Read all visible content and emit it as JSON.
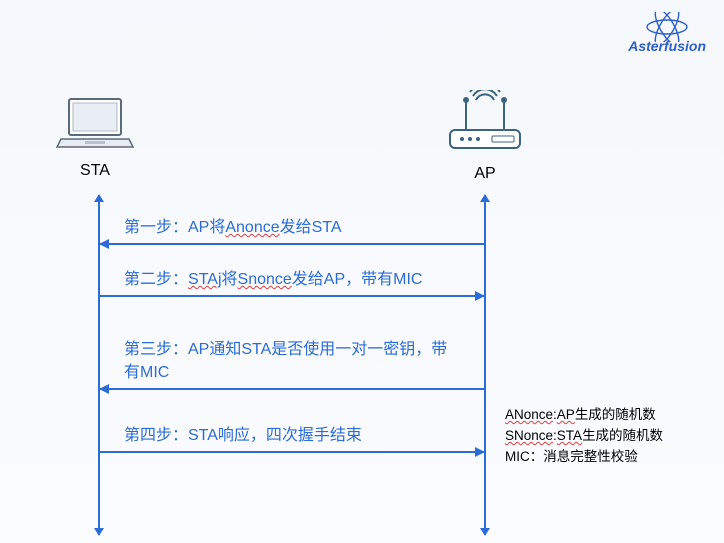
{
  "brand": {
    "name": "Asterfusion"
  },
  "nodes": {
    "sta": {
      "label": "STA"
    },
    "ap": {
      "label": "AP"
    }
  },
  "steps": {
    "s1": {
      "prefix": "第一步：AP将",
      "underlined": "Anonce",
      "suffix": "发给STA"
    },
    "s2": {
      "prefix": "第二步：",
      "underlined": "STAj",
      "mid": "将",
      "underlined2": "Snonce",
      "suffix": "发给AP，带有MIC"
    },
    "s3": {
      "text": "第三步：AP通知STA是否使用一对一密钥，带有MIC"
    },
    "s4": {
      "text": "第四步：STA响应，四次握手结束"
    }
  },
  "legend": {
    "l1": {
      "key": "ANonce",
      "sep": ":",
      "who": "AP",
      "rest": "生成的随机数"
    },
    "l2": {
      "key": "SNonce",
      "sep": ":",
      "who": "STA",
      "rest": "生成的随机数"
    },
    "l3": {
      "text": "MIC：消息完整性校验"
    }
  }
}
